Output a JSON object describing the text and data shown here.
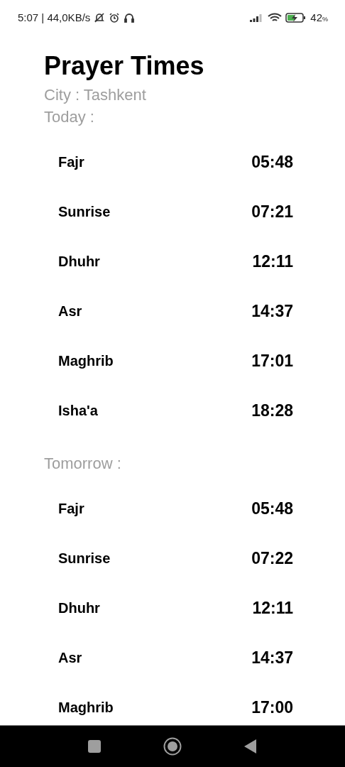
{
  "status_bar": {
    "time": "5:07 | 44,0KB/s",
    "battery": "42",
    "battery_unit": "%"
  },
  "title": "Prayer Times",
  "city": "City : Tashkent",
  "days": [
    {
      "label": "Today :",
      "prayers": [
        {
          "name": "Fajr",
          "time": "05:48"
        },
        {
          "name": "Sunrise",
          "time": "07:21"
        },
        {
          "name": "Dhuhr",
          "time": "12:11"
        },
        {
          "name": "Asr",
          "time": "14:37"
        },
        {
          "name": "Maghrib",
          "time": "17:01"
        },
        {
          "name": "Isha'a",
          "time": "18:28"
        }
      ]
    },
    {
      "label": "Tomorrow :",
      "prayers": [
        {
          "name": "Fajr",
          "time": "05:48"
        },
        {
          "name": "Sunrise",
          "time": "07:22"
        },
        {
          "name": "Dhuhr",
          "time": "12:11"
        },
        {
          "name": "Asr",
          "time": "14:37"
        },
        {
          "name": "Maghrib",
          "time": "17:00"
        }
      ]
    }
  ]
}
